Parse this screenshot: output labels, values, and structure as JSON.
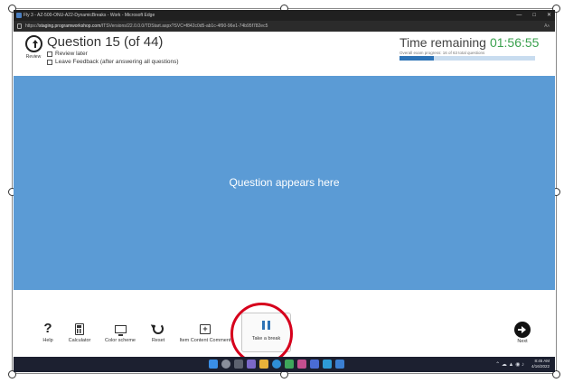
{
  "browser": {
    "title": "Fly 3 - AZ-500-ONU-A22-DynamicBreaks - Work - Microsoft Edge",
    "url_prefix": "https://",
    "url_host": "staging.programworkshop.com",
    "url_path": "/ITSVersions/22.0.0.0/TDStart.aspx?SVC=f842c0d5-ab1c-4f90-96e1-74b95f782ec5",
    "reader_label": "Aᴀ",
    "minimize_glyph": "—",
    "maximize_glyph": "□",
    "close_glyph": "✕"
  },
  "header": {
    "review_label": "Review",
    "question_title": "Question 15 (of 44)",
    "review_later_label": "Review later",
    "leave_feedback_label": "Leave Feedback (after answering all questions)",
    "time_label": "Time remaining",
    "time_value": "01:56:55",
    "progress_text": "Overall exam progress: 16 of 63 total questions",
    "progress_fraction": 0.254,
    "progress_color": "#2d73b6",
    "time_color": "#3aa14e"
  },
  "question": {
    "placeholder": "Question appears here",
    "background_color": "#5b9bd5"
  },
  "toolbar": {
    "help_label": "Help",
    "help_glyph": "?",
    "calculator_label": "Calculator",
    "color_scheme_label": "Color scheme",
    "reset_label": "Reset",
    "comment_label": "Item Content Comment",
    "comment_glyph": "+",
    "break_label": "Take a break",
    "next_label": "Next",
    "highlight_color": "#d6001c"
  },
  "taskbar": {
    "tray_glyphs": "⌃  ☁  ▲  ◉  ♪",
    "time": "8:45 AM",
    "date": "4/16/2022"
  }
}
